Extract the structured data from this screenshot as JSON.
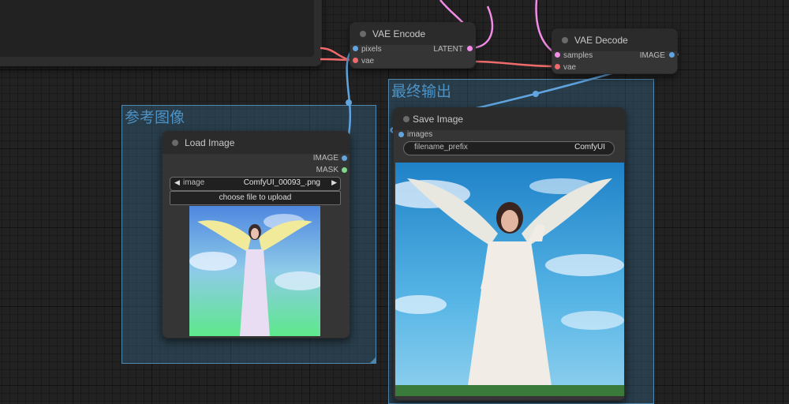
{
  "colors": {
    "image_link": "#60a5e0",
    "latent_link": "#f28ce6",
    "vae_link": "#ef6b6b",
    "group_title": "#4e93c6"
  },
  "vae_encode": {
    "title": "VAE Encode",
    "inputs": [
      "pixels",
      "vae"
    ],
    "output": "LATENT"
  },
  "vae_decode": {
    "title": "VAE Decode",
    "inputs": [
      "samples",
      "vae"
    ],
    "output": "IMAGE"
  },
  "group_reference": {
    "title": "参考图像"
  },
  "group_output": {
    "title": "最终输出"
  },
  "load_image": {
    "title": "Load Image",
    "outputs": [
      "IMAGE",
      "MASK"
    ],
    "image_widget_label": "image",
    "image_widget_value": "ComfyUI_00093_.png",
    "upload_button": "choose file to upload",
    "preview_icon": "angel-thumbnail"
  },
  "save_image": {
    "title": "Save Image",
    "input": "images",
    "prefix_label": "filename_prefix",
    "prefix_value": "ComfyUI",
    "preview_icon": "angel-output"
  }
}
